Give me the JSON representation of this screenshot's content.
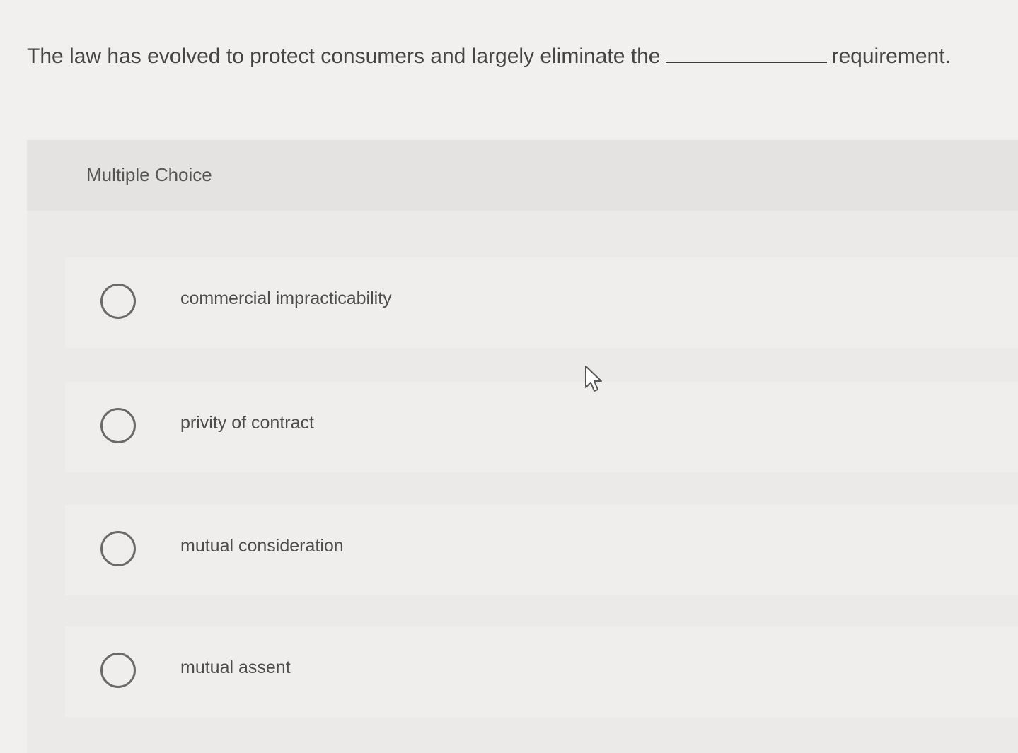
{
  "question": {
    "text_before": "The law has evolved to protect consumers and largely eliminate the",
    "text_after": "requirement."
  },
  "card": {
    "header_label": "Multiple Choice"
  },
  "options": [
    {
      "label": "commercial impracticability",
      "selected": false
    },
    {
      "label": "privity of contract",
      "selected": false
    },
    {
      "label": "mutual consideration",
      "selected": false
    },
    {
      "label": "mutual assent",
      "selected": false
    }
  ],
  "icons": {
    "radio": "radio-unchecked-icon",
    "cursor": "mouse-pointer-icon"
  }
}
